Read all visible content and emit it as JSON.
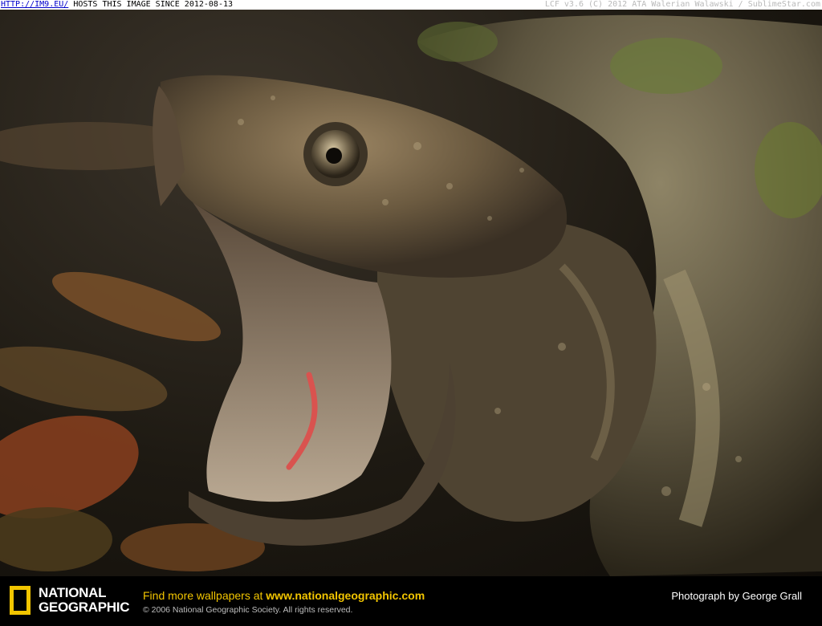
{
  "watermark": {
    "link_text": "HTTP://IM9.EU/",
    "left_text": "HOSTS THIS IMAGE SINCE 2012-08-13",
    "right_text": "LCF v3.6 (C) 2012 ATA Walerian Walawski / SublimeStar.com"
  },
  "footer": {
    "logo_line1": "NATIONAL",
    "logo_line2": "GEOGRAPHIC",
    "promo_prefix": "Find more wallpapers at",
    "promo_url": "www.nationalgeographic.com",
    "copyright": "© 2006 National Geographic Society. All rights reserved.",
    "credit": "Photograph by George Grall"
  },
  "colors": {
    "brand_yellow": "#f2c500",
    "footer_bg": "#000000"
  },
  "photo": {
    "subject": "alligator-snapping-turtle"
  }
}
